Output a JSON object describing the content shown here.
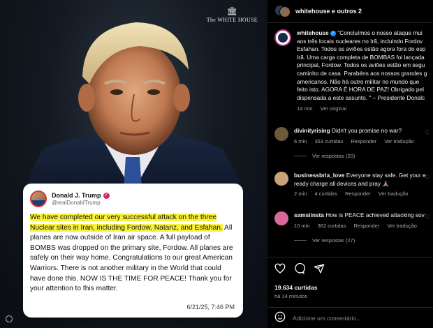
{
  "logo": {
    "building_glyph": "🏛",
    "text": "The WHITE HOUSE"
  },
  "tweet": {
    "name": "Donald J. Trump",
    "handle": "@realDonaldTrump",
    "highlighted": "We have completed our very successful attack on the three Nuclear sites in Iran, including Fordow, Natanz, and Esfahan.",
    "rest": " All planes are now outside of Iran air space. A full payload of BOMBS was dropped on the primary site, Fordow. All planes are safely on their way home. Congratulations to our great American Warriors. There is not another military in the World that could have done this. NOW IS THE TIME FOR PEACE! Thank you for your attention to this matter.",
    "timestamp": "6/21/25, 7:46 PM"
  },
  "panel": {
    "header_title": "whitehouse e outros 2",
    "caption": {
      "username": "whitehouse",
      "lines": [
        "\"Concluímos o nosso ataque mui",
        "aos três locais nucleares no Irã, incluindo Fordov",
        "Esfahan. Todos os aviões estão agora fora do esp",
        "Irã. Uma carga completa de BOMBAS foi lançada",
        "principal, Fordow. Todos os aviões estão em segu",
        "caminho de casa. Parabéns aos nossos grandes g",
        "americanos. Não há outro militar no mundo que",
        "feito isto. AGORA É HORA DE PAZ! Obrigado pel",
        "dispensada a este assunto. \" – Presidente Donalc"
      ],
      "time": "14 min",
      "translation": "Ver original"
    },
    "comments": [
      {
        "username": "divinityrising",
        "text": "Didn't you promise no war?",
        "time": "6 min",
        "likes": "353 curtidas",
        "reply": "Responder",
        "translate": "Ver tradução",
        "replies": "Ver respostas (20)",
        "avatar_color": "#6b5a3a"
      },
      {
        "username": "businessbria_love",
        "text_line1": "Everyone stay safe. Get your e",
        "text_line2": "ready charge all devices and pray 🙏🏽",
        "time": "2 min",
        "likes": "4 curtidas",
        "reply": "Responder",
        "translate": "Ver tradução",
        "avatar_color": "#c9a27a"
      },
      {
        "username": "samsiinsta",
        "text": "How is PEACE achieved attacking sov",
        "time": "10 min",
        "likes": "362 curtidas",
        "reply": "Responder",
        "translate": "Ver tradução",
        "replies": "Ver respostas (27)",
        "avatar_color": "#d66a9a"
      }
    ],
    "likes_total": "19.634 curtidas",
    "posted_ago": "há 14 minutos",
    "comment_placeholder": "Adicione um comentário..."
  }
}
